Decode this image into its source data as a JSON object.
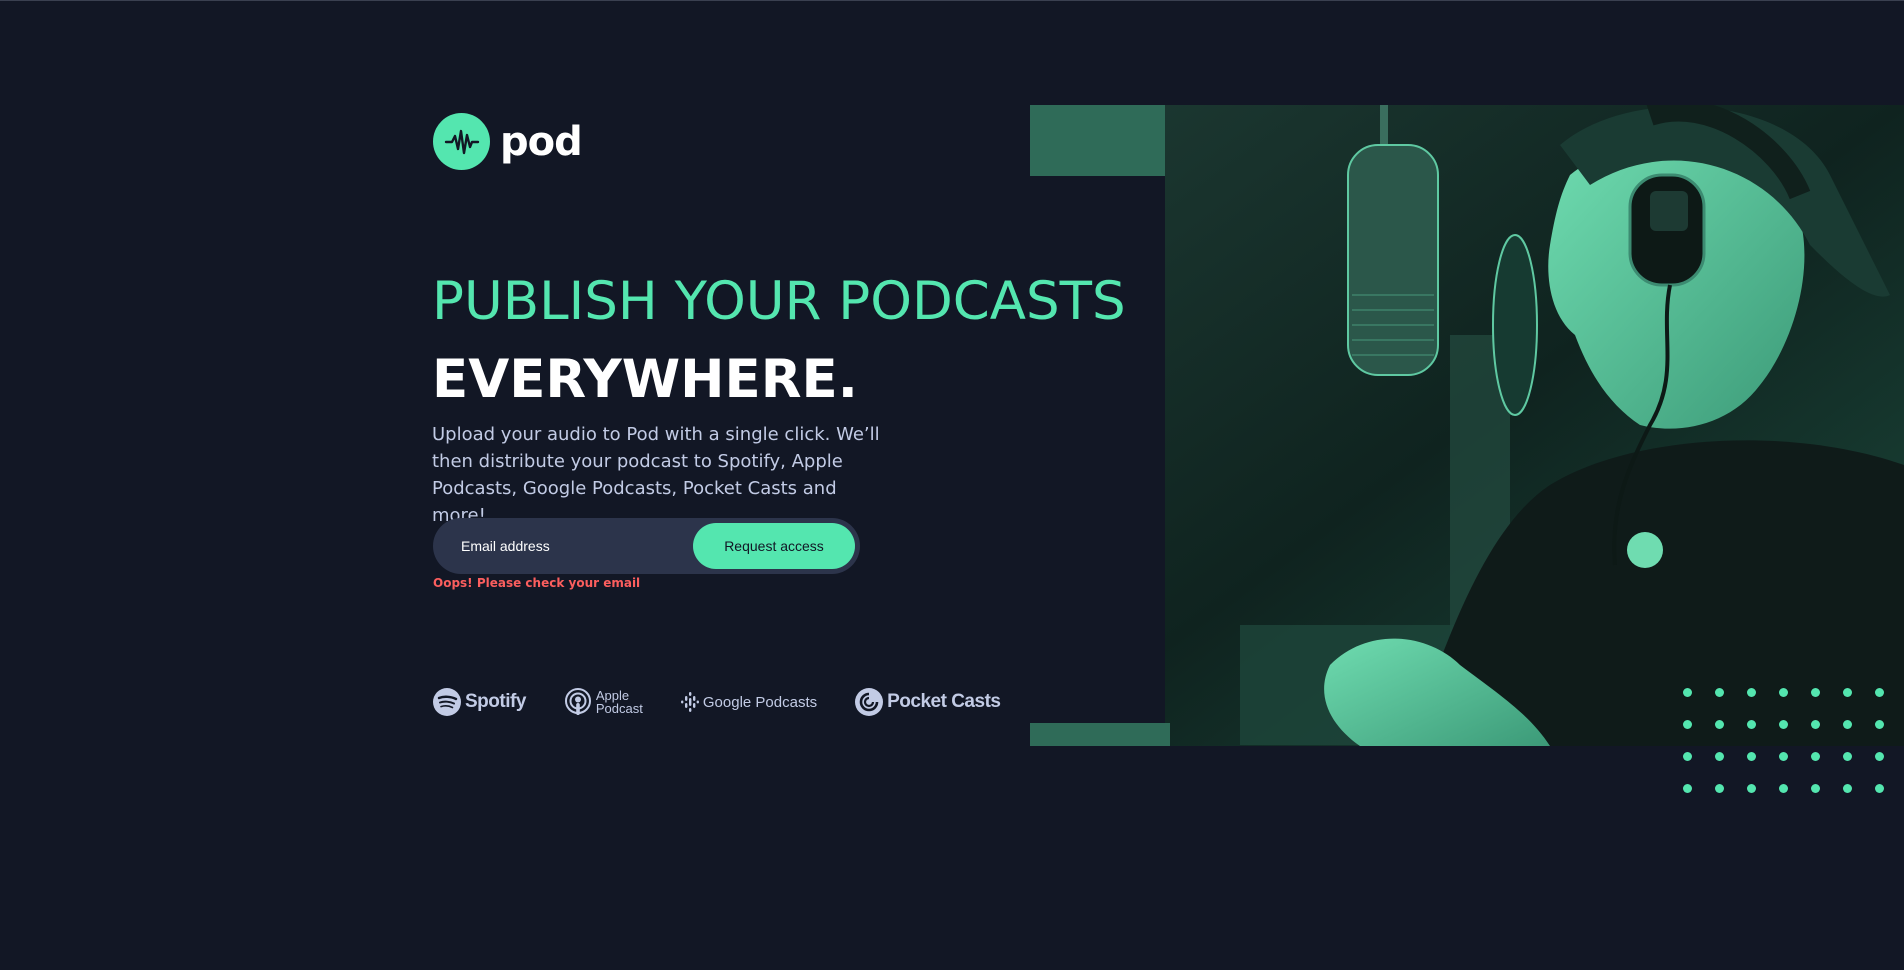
{
  "brand": {
    "name": "pod"
  },
  "hero": {
    "title_line1": "PUBLISH YOUR PODCASTS",
    "title_line2": "EVERYWHERE.",
    "description": "Upload your audio to Pod with a single click. We’ll then distribute your podcast to Spotify, Apple Podcasts, Google Podcasts, Pocket Casts and more!"
  },
  "form": {
    "email_placeholder": "Email address",
    "email_value": "",
    "submit_label": "Request access",
    "error_message": "Oops! Please check your email"
  },
  "platforms": [
    {
      "name": "Spotify",
      "icon": "spotify-icon"
    },
    {
      "name": "Apple",
      "name2": "Podcast",
      "icon": "apple-podcast-icon"
    },
    {
      "name": "Google Podcasts",
      "icon": "google-podcasts-icon"
    },
    {
      "name": "Pocket Casts",
      "icon": "pocket-casts-icon"
    }
  ],
  "colors": {
    "background": "#121725",
    "accent": "#54e6af",
    "input_bg": "#2c344b",
    "text_muted": "#c2cbe5",
    "error": "#fb5e5e"
  }
}
